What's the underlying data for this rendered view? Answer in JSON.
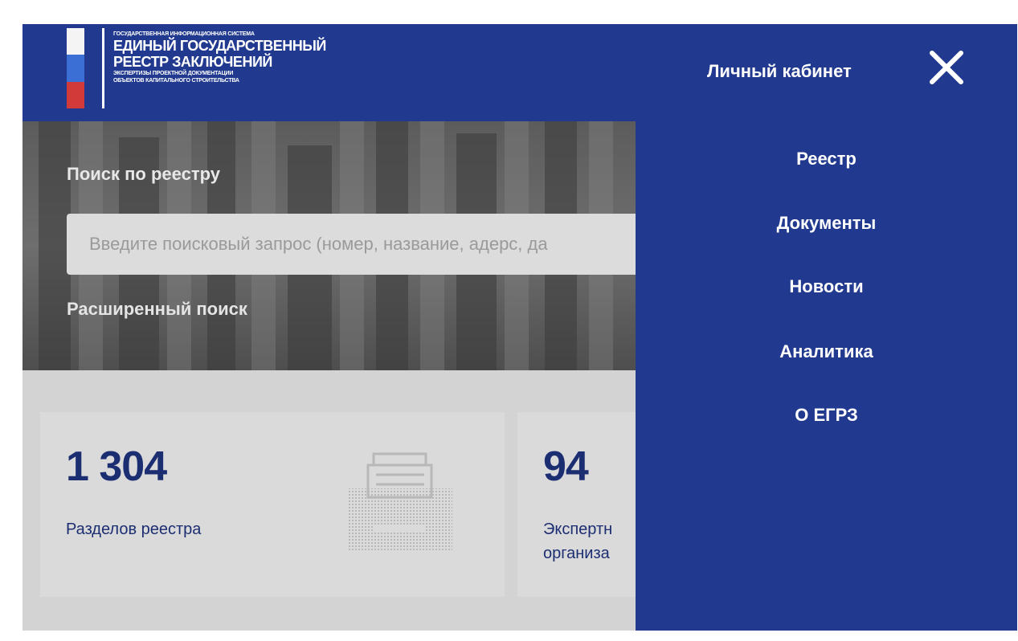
{
  "logo": {
    "line1": "Государственная информационная система",
    "line2": "Единый государственный",
    "line3": "реестр заключений",
    "line4": "экспертизы проектной документации",
    "line5": "объектов капитального строительства"
  },
  "header": {
    "cabinet_label": "Личный кабинет",
    "close_icon": "close-icon"
  },
  "hero": {
    "title": "Поиск по реестру",
    "search_placeholder": "Введите поисковый запрос (номер, название, адерс, да",
    "advanced_link": "Расширенный поиск"
  },
  "stats": [
    {
      "number": "1 304",
      "label": "Разделов реестра"
    },
    {
      "number": "94",
      "label": "Экспертн организа"
    }
  ],
  "menu": {
    "items": [
      {
        "label": "Реестр"
      },
      {
        "label": "Документы"
      },
      {
        "label": "Новости"
      },
      {
        "label": "Аналитика"
      },
      {
        "label": "О ЕГРЗ"
      }
    ]
  },
  "colors": {
    "brand_blue": "#213a8f",
    "number_blue": "#1c2e72",
    "flag_white": "#f4f4f4",
    "flag_blue": "#3b6fd6",
    "flag_red": "#d23a3a"
  }
}
